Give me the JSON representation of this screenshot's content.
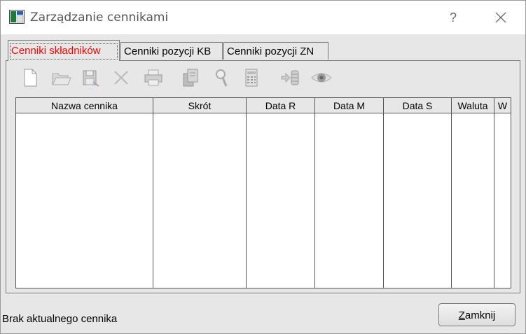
{
  "window": {
    "title": "Zarządzanie cennikami",
    "help_label": "?"
  },
  "tabs": [
    {
      "label": "Cenniki składników",
      "active": true
    },
    {
      "label": "Cenniki pozycji KB",
      "active": false
    },
    {
      "label": "Cenniki pozycji ZN",
      "active": false
    }
  ],
  "toolbar": {
    "icons": [
      "new-document-icon",
      "open-folder-icon",
      "save-icon",
      "delete-icon",
      "print-icon",
      "copy-icon",
      "search-icon",
      "calculator-icon",
      "import-icon",
      "preview-eye-icon"
    ]
  },
  "grid": {
    "columns": [
      "Nazwa cennika",
      "Skrót",
      "Data R",
      "Data M",
      "Data S",
      "Waluta",
      "W"
    ],
    "rows": []
  },
  "status": {
    "text": "Brak aktualnego cennika"
  },
  "buttons": {
    "close_mnemonic": "Z",
    "close_rest": "amknij"
  },
  "colors": {
    "active_tab_text": "#ff0000",
    "panel_bg": "#e7e7e7"
  }
}
